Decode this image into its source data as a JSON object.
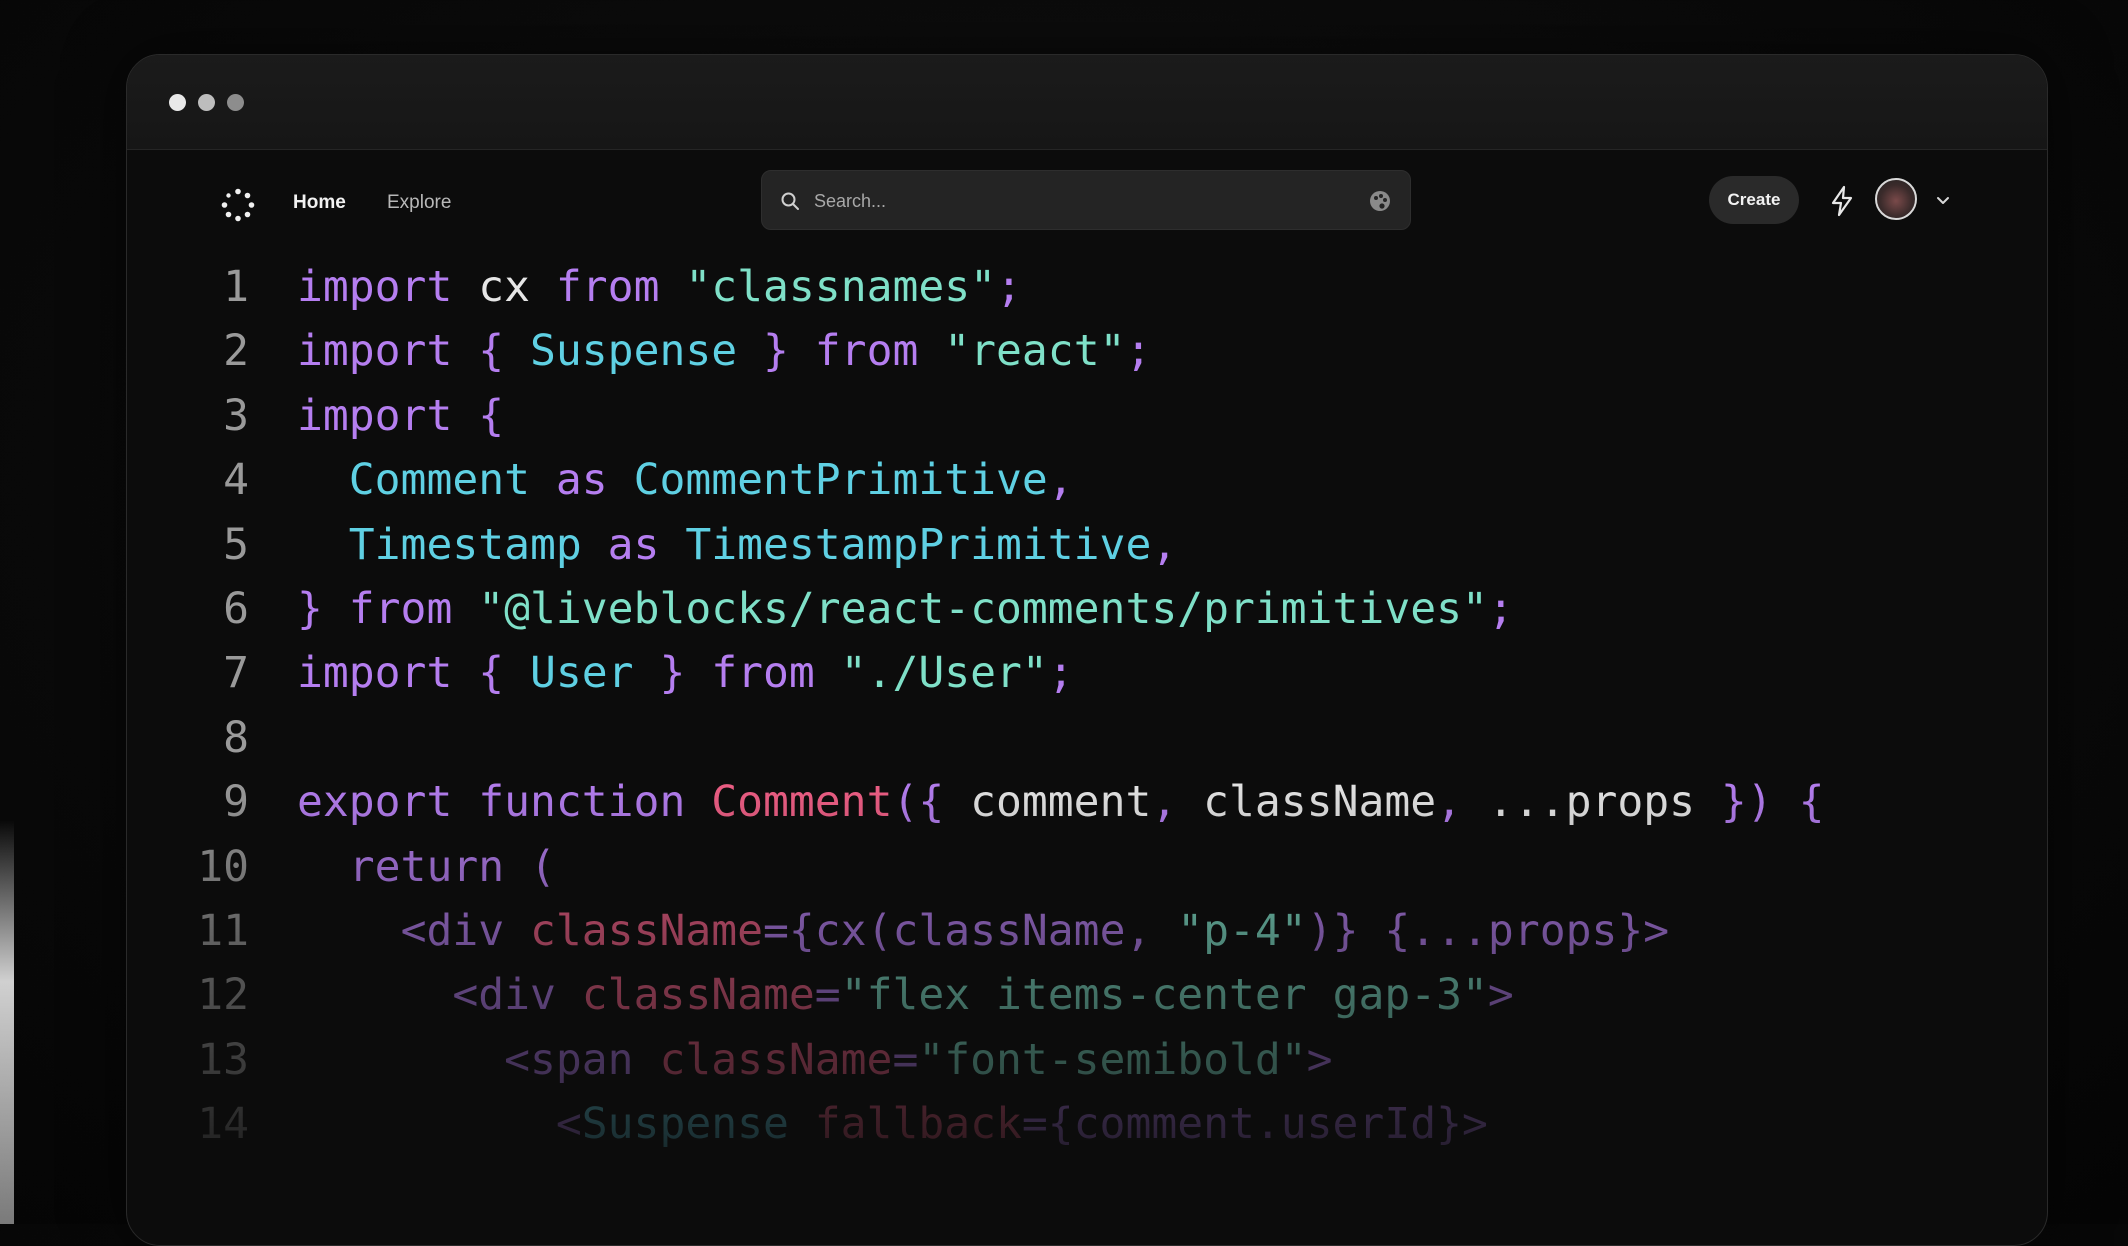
{
  "nav": {
    "home": "Home",
    "explore": "Explore",
    "search_placeholder": "Search...",
    "create": "Create"
  },
  "code": {
    "line_numbers": [
      "1",
      "2",
      "3",
      "4",
      "5",
      "6",
      "7",
      "8",
      "9",
      "10",
      "11",
      "12",
      "13",
      "14"
    ],
    "lines": [
      [
        {
          "t": "import",
          "c": "kw"
        },
        {
          "t": " cx ",
          "c": "plain"
        },
        {
          "t": "from",
          "c": "kw"
        },
        {
          "t": " ",
          "c": "plain"
        },
        {
          "t": "\"classnames\"",
          "c": "str"
        },
        {
          "t": ";",
          "c": "pun"
        }
      ],
      [
        {
          "t": "import",
          "c": "kw"
        },
        {
          "t": " { ",
          "c": "pun"
        },
        {
          "t": "Suspense",
          "c": "id"
        },
        {
          "t": " } ",
          "c": "pun"
        },
        {
          "t": "from",
          "c": "kw"
        },
        {
          "t": " ",
          "c": "plain"
        },
        {
          "t": "\"react\"",
          "c": "str"
        },
        {
          "t": ";",
          "c": "pun"
        }
      ],
      [
        {
          "t": "import",
          "c": "kw"
        },
        {
          "t": " {",
          "c": "pun"
        }
      ],
      [
        {
          "t": "  ",
          "c": "plain"
        },
        {
          "t": "Comment",
          "c": "id"
        },
        {
          "t": " as ",
          "c": "kw"
        },
        {
          "t": "CommentPrimitive",
          "c": "id"
        },
        {
          "t": ",",
          "c": "pun"
        }
      ],
      [
        {
          "t": "  ",
          "c": "plain"
        },
        {
          "t": "Timestamp",
          "c": "id"
        },
        {
          "t": " as ",
          "c": "kw"
        },
        {
          "t": "TimestampPrimitive",
          "c": "id"
        },
        {
          "t": ",",
          "c": "pun"
        }
      ],
      [
        {
          "t": "}",
          "c": "pun"
        },
        {
          "t": " from ",
          "c": "kw"
        },
        {
          "t": "\"@liveblocks/react-comments/primitives\"",
          "c": "str"
        },
        {
          "t": ";",
          "c": "pun"
        }
      ],
      [
        {
          "t": "import",
          "c": "kw"
        },
        {
          "t": " { ",
          "c": "pun"
        },
        {
          "t": "User",
          "c": "id"
        },
        {
          "t": " } ",
          "c": "pun"
        },
        {
          "t": "from",
          "c": "kw"
        },
        {
          "t": " ",
          "c": "plain"
        },
        {
          "t": "\"./User\"",
          "c": "str"
        },
        {
          "t": ";",
          "c": "pun"
        }
      ],
      [],
      [
        {
          "t": "export",
          "c": "kw"
        },
        {
          "t": " function ",
          "c": "kw"
        },
        {
          "t": "Comment",
          "c": "fn"
        },
        {
          "t": "({",
          "c": "pun"
        },
        {
          "t": " comment",
          "c": "plain"
        },
        {
          "t": ",",
          "c": "pun"
        },
        {
          "t": " className",
          "c": "plain"
        },
        {
          "t": ",",
          "c": "pun"
        },
        {
          "t": " ...props ",
          "c": "plain"
        },
        {
          "t": "}) {",
          "c": "pun"
        }
      ],
      [
        {
          "t": "  ",
          "c": "plain"
        },
        {
          "t": "return",
          "c": "kw"
        },
        {
          "t": " (",
          "c": "pun"
        }
      ],
      [
        {
          "t": "    ",
          "c": "plain"
        },
        {
          "t": "<div",
          "c": "kw"
        },
        {
          "t": " className",
          "c": "attr"
        },
        {
          "t": "={",
          "c": "pun"
        },
        {
          "t": "cx",
          "c": "kw"
        },
        {
          "t": "(",
          "c": "pun"
        },
        {
          "t": "className",
          "c": "kw"
        },
        {
          "t": ", ",
          "c": "pun"
        },
        {
          "t": "\"p-4\"",
          "c": "str"
        },
        {
          "t": ")}",
          "c": "pun"
        },
        {
          "t": " {...props}>",
          "c": "kw"
        }
      ],
      [
        {
          "t": "      ",
          "c": "plain"
        },
        {
          "t": "<div",
          "c": "kw"
        },
        {
          "t": " className",
          "c": "attr"
        },
        {
          "t": "=",
          "c": "pun"
        },
        {
          "t": "\"flex items-center gap-3\"",
          "c": "str"
        },
        {
          "t": ">",
          "c": "kw"
        }
      ],
      [
        {
          "t": "        ",
          "c": "plain"
        },
        {
          "t": "<span",
          "c": "kw"
        },
        {
          "t": " className",
          "c": "attr"
        },
        {
          "t": "=",
          "c": "pun"
        },
        {
          "t": "\"font-semibold\"",
          "c": "str"
        },
        {
          "t": ">",
          "c": "kw"
        }
      ],
      [
        {
          "t": "          ",
          "c": "plain"
        },
        {
          "t": "<",
          "c": "kw"
        },
        {
          "t": "Suspense",
          "c": "id"
        },
        {
          "t": " fallback",
          "c": "attr"
        },
        {
          "t": "={comment.userId}>",
          "c": "kw"
        }
      ]
    ]
  }
}
